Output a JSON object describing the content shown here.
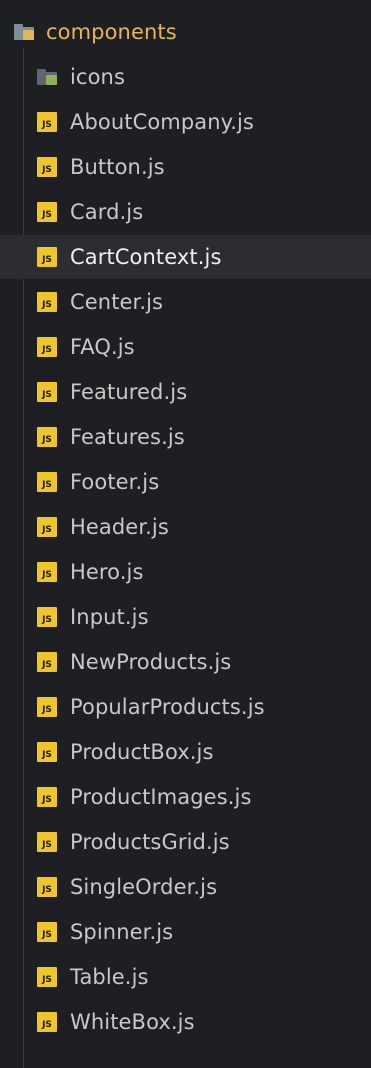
{
  "explorer": {
    "folder": {
      "name": "components",
      "icon": "folder-icon",
      "label_color": "#e4b65a"
    },
    "subfolder": {
      "name": "icons",
      "icon": "folder-icon"
    },
    "js_icon_text": "JS",
    "js_icon_color": "#f0c529",
    "files": [
      {
        "name": "AboutCompany.js",
        "selected": false
      },
      {
        "name": "Button.js",
        "selected": false
      },
      {
        "name": "Card.js",
        "selected": false
      },
      {
        "name": "CartContext.js",
        "selected": true
      },
      {
        "name": "Center.js",
        "selected": false
      },
      {
        "name": "FAQ.js",
        "selected": false
      },
      {
        "name": "Featured.js",
        "selected": false
      },
      {
        "name": "Features.js",
        "selected": false
      },
      {
        "name": "Footer.js",
        "selected": false
      },
      {
        "name": "Header.js",
        "selected": false
      },
      {
        "name": "Hero.js",
        "selected": false
      },
      {
        "name": "Input.js",
        "selected": false
      },
      {
        "name": "NewProducts.js",
        "selected": false
      },
      {
        "name": "PopularProducts.js",
        "selected": false
      },
      {
        "name": "ProductBox.js",
        "selected": false
      },
      {
        "name": "ProductImages.js",
        "selected": false
      },
      {
        "name": "ProductsGrid.js",
        "selected": false
      },
      {
        "name": "SingleOrder.js",
        "selected": false
      },
      {
        "name": "Spinner.js",
        "selected": false
      },
      {
        "name": "Table.js",
        "selected": false
      },
      {
        "name": "WhiteBox.js",
        "selected": false
      }
    ]
  }
}
